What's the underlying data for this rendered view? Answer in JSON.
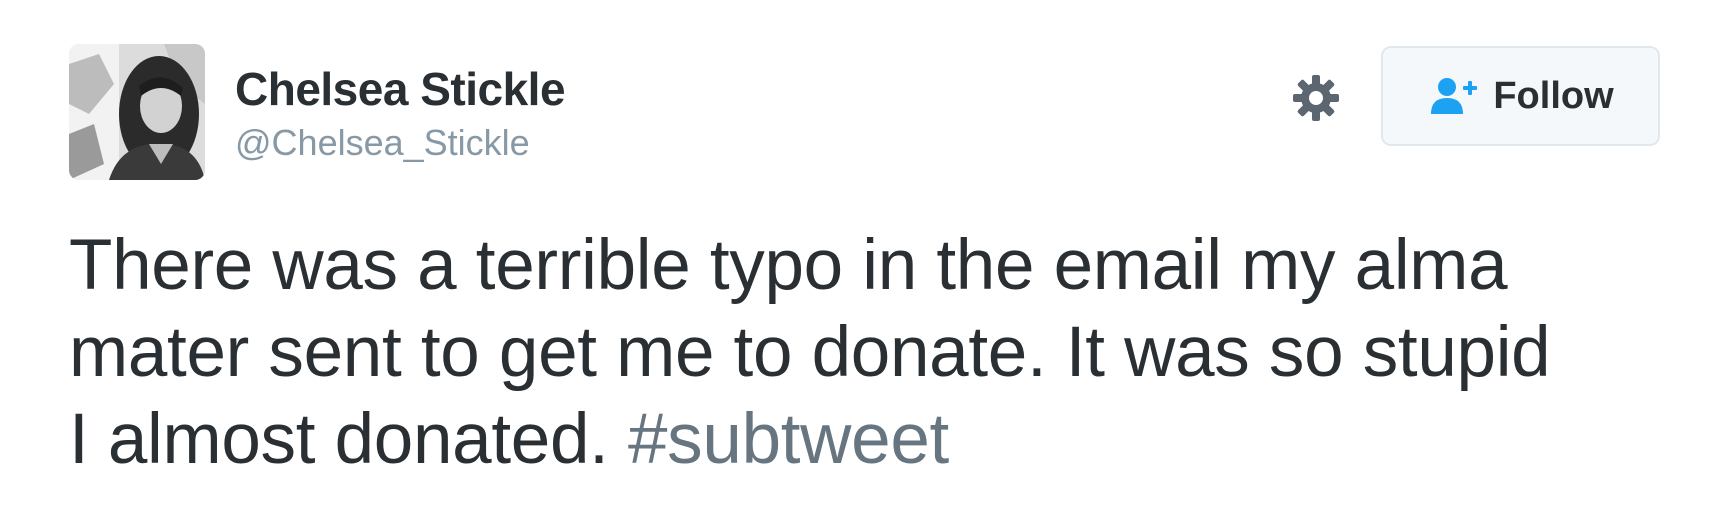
{
  "tweet": {
    "author": {
      "display_name": "Chelsea Stickle",
      "handle": "@Chelsea_Stickle",
      "avatar": "profile-photo"
    },
    "actions": {
      "settings_icon": "gear-icon",
      "follow_icon": "add-user-icon",
      "follow_label": "Follow"
    },
    "text": {
      "line1": "There was a terrible typo in the email my alma",
      "line2": "mater sent to get me to donate. It was so stupid",
      "line3_plain": "I almost donated. ",
      "hashtag": "#subtweet"
    },
    "colors": {
      "text": "#292f33",
      "handle": "#8899a6",
      "hashtag": "#66757f",
      "follow_icon": "#1da1f2",
      "button_bg": "#f5f8fa",
      "button_border": "#e1e8ed"
    }
  }
}
